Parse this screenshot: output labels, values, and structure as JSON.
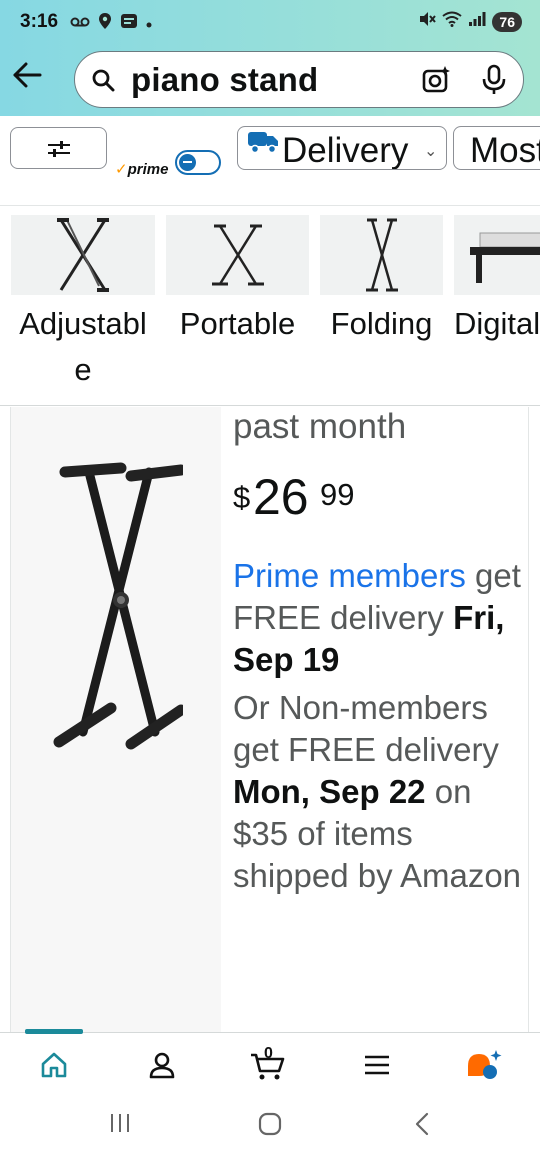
{
  "status_bar": {
    "time": "3:16",
    "battery": "76"
  },
  "search": {
    "query": "piano stand"
  },
  "filters": {
    "prime_label": "prime",
    "prime_check": "✓",
    "delivery_label": "Delivery",
    "most_label": "Most"
  },
  "categories": [
    {
      "label": "Adjustable"
    },
    {
      "label": "Portable"
    },
    {
      "label": "Folding"
    },
    {
      "label": "Digital"
    }
  ],
  "product": {
    "bought_text": "past month",
    "price_symbol": "$",
    "price_whole": "26",
    "price_fraction": "99",
    "prime_members": "Prime members",
    "delivery_line1": "get FREE delivery",
    "delivery_date": "Fri, Sep 19",
    "nonmember_line": "Or Non-members get FREE delivery",
    "nonmember_date": "Mon, Sep 22",
    "nonmember_tail": "on $35 of items shipped by Amazon"
  },
  "bottom_nav": {
    "cart_count": "0"
  },
  "colors": {
    "header_gradient_start": "#86d8e3",
    "header_gradient_end": "#a4e4d2",
    "prime_blue": "#1a73e8",
    "accent_teal": "#1b8a9a",
    "rufus_orange": "#ff6a00"
  }
}
